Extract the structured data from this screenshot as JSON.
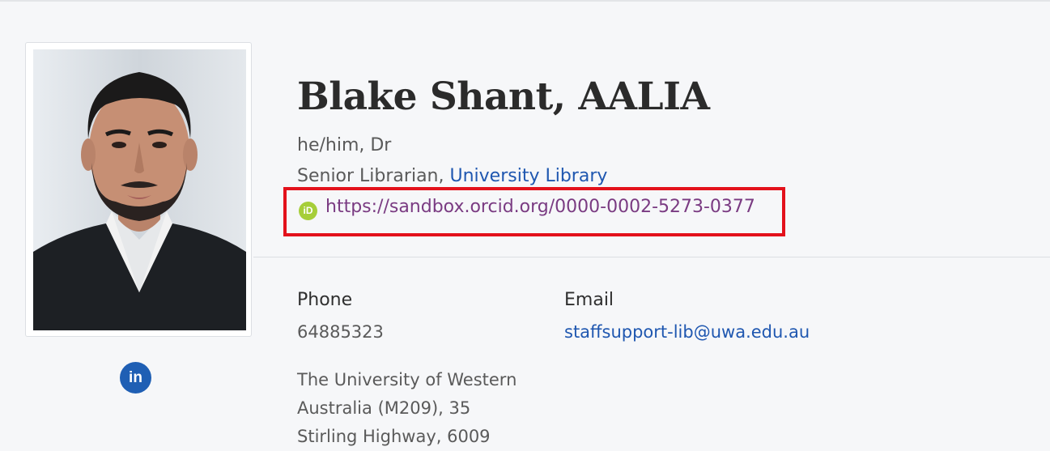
{
  "profile": {
    "name": "Blake Shant, AALIA",
    "pronouns": "he/him, Dr",
    "position_prefix": "Senior Librarian, ",
    "organisation": "University Library",
    "orcid_url": "https://sandbox.orcid.org/0000-0002-5273-0377",
    "orcid_icon_text": "iD",
    "linkedin_icon_text": "in"
  },
  "contact": {
    "phone_label": "Phone",
    "phone_value": "64885323",
    "email_label": "Email",
    "email_value": "staffsupport-lib@uwa.edu.au",
    "address_lines": [
      "The University of Western",
      "Australia (M209), 35",
      "Stirling Highway, 6009"
    ]
  },
  "colors": {
    "link": "#1f57b0",
    "orcid_link": "#7a3b82",
    "orcid_green": "#a6ce39",
    "highlight": "#e3111b",
    "linkedin": "#1f5fb4"
  }
}
